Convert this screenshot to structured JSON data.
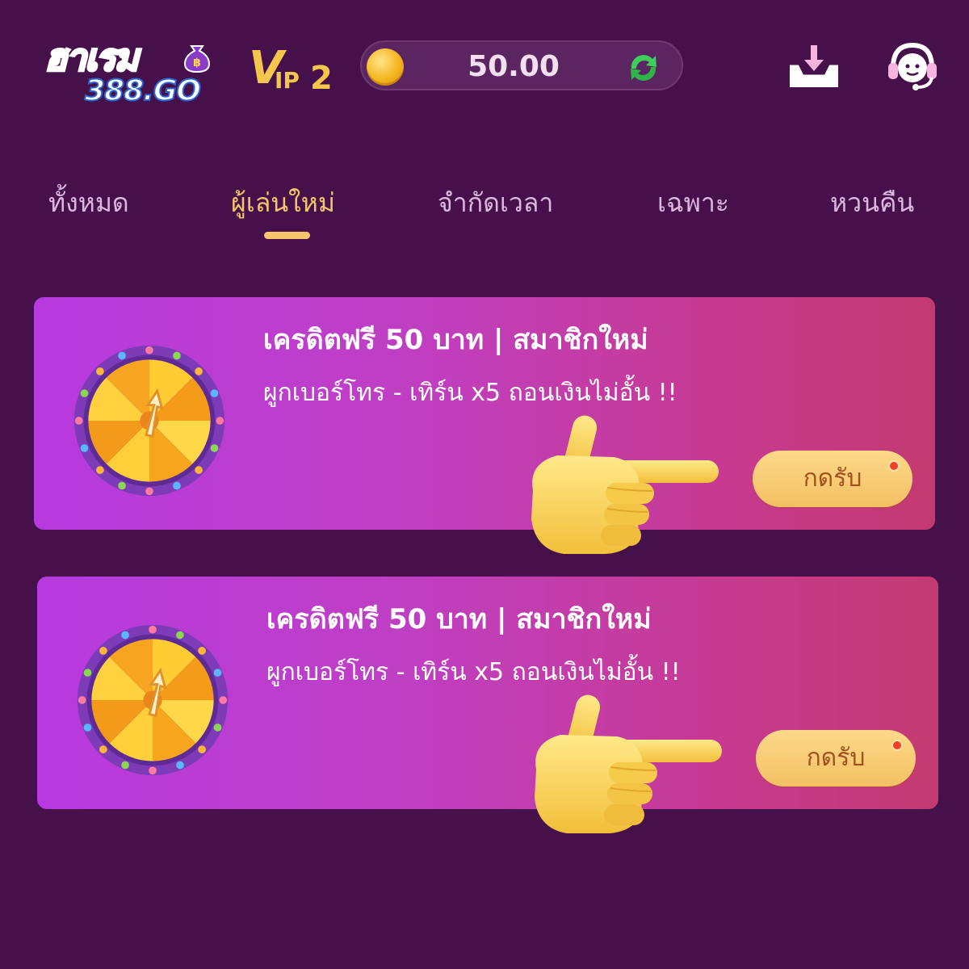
{
  "header": {
    "logo": {
      "text_top": "ฮาเรม",
      "text_bottom": "388.GO"
    },
    "vip": {
      "prefix": "V",
      "label": "IP",
      "level": "2"
    },
    "balance": {
      "amount": "50.00"
    },
    "icons": [
      "coin-icon",
      "refresh-icon",
      "download-icon",
      "support-headset-icon"
    ]
  },
  "tabs": [
    {
      "label": "ทั้งหมด",
      "active": false
    },
    {
      "label": "ผู้เล่นใหม่",
      "active": true
    },
    {
      "label": "จำกัดเวลา",
      "active": false
    },
    {
      "label": "เฉพาะ",
      "active": false
    },
    {
      "label": "หวนคืน",
      "active": false
    }
  ],
  "promotions": [
    {
      "title": "เครดิตฟรี 50 บาท | สมาชิกใหม่",
      "subtitle": "ผูกเบอร์โทร - เทิร์น x5 ถอนเงินไม่อั้น !!",
      "button_label": "กดรับ",
      "icon": "prize-wheel-icon"
    },
    {
      "title": "เครดิตฟรี 50 บาท | สมาชิกใหม่",
      "subtitle": "ผูกเบอร์โทร - เทิร์น x5 ถอนเงินไม่อั้น !!",
      "button_label": "กดรับ",
      "icon": "prize-wheel-icon"
    }
  ],
  "colors": {
    "background": "#46104a",
    "accent_gold": "#f4c66a",
    "tab_inactive": "#dcb7df",
    "card_gradient_start": "#b73ae0",
    "card_gradient_end": "#c33a70",
    "notification_dot": "#f0402a"
  }
}
